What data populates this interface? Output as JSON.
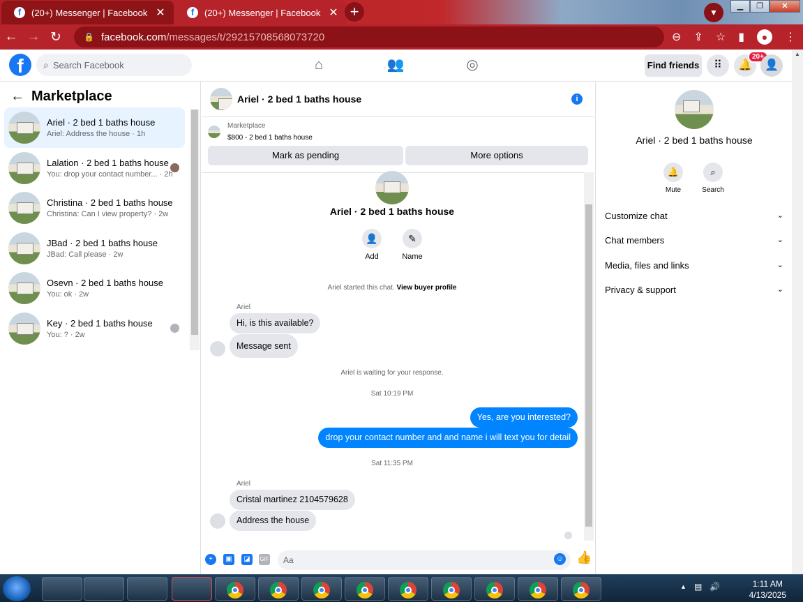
{
  "browser": {
    "tabs": [
      {
        "title": "(20+) Messenger | Facebook"
      },
      {
        "title": "(20+) Messenger | Facebook"
      }
    ],
    "url_host": "facebook.com",
    "url_path": "/messages/t/29215708568073720"
  },
  "header": {
    "search_placeholder": "Search Facebook",
    "find_friends": "Find friends",
    "notification_badge": "20+"
  },
  "sidebar": {
    "title": "Marketplace",
    "conversations": [
      {
        "name": "Ariel · 2 bed 1 baths house",
        "preview": "Ariel: Address the house · 1h"
      },
      {
        "name": "Lalation · 2 bed 1 baths house",
        "preview": "You: drop your contact number... · 2h"
      },
      {
        "name": "Christina · 2 bed 1 baths house",
        "preview": "Christina: Can I view property? · 2w"
      },
      {
        "name": "JBad · 2 bed 1 baths house",
        "preview": "JBad: Call please · 2w"
      },
      {
        "name": "Osevn · 2 bed 1 baths house",
        "preview": "You: ok · 2w"
      },
      {
        "name": "Key · 2 bed 1 baths house",
        "preview": "You: ? · 2w"
      }
    ]
  },
  "chat": {
    "title": "Ariel · 2 bed 1 baths house",
    "listing_label": "Marketplace",
    "listing_detail": "$800 - 2 bed 1 baths house",
    "mark_pending": "Mark as pending",
    "more_options": "More options",
    "hero_title": "Ariel · 2 bed 1 baths house",
    "add_label": "Add",
    "name_label": "Name",
    "started_note": "Ariel started this chat.",
    "view_profile": "View buyer profile",
    "sender1": "Ariel",
    "msg1": "Hi, is this available?",
    "msg2": "Message sent",
    "waiting_note": "Ariel is waiting for your response.",
    "time1": "Sat 10:19 PM",
    "out1": "Yes, are you interested?",
    "out2": "drop your contact number and and name i will text you for detail",
    "time2": "Sat 11:35 PM",
    "sender2": "Ariel",
    "msg3": "Cristal martinez  2104579628",
    "msg4": "Address the house",
    "composer_placeholder": "Aa",
    "gif_label": "GIF"
  },
  "right_panel": {
    "title": "Ariel · 2 bed 1 baths house",
    "mute_label": "Mute",
    "search_label": "Search",
    "rows": [
      "Customize chat",
      "Chat members",
      "Media, files and links",
      "Privacy & support"
    ]
  },
  "taskbar": {
    "time": "1:11 AM",
    "date": "4/13/2025"
  },
  "icons": [
    "facebook-icon",
    "search-icon",
    "home-icon",
    "friends-icon",
    "groups-icon",
    "grid-icon",
    "bell-icon",
    "account-icon",
    "info-icon",
    "add-person-icon",
    "pencil-icon",
    "plus-icon",
    "image-icon",
    "sticker-icon",
    "gif-icon",
    "emoji-icon",
    "like-icon",
    "chevron-down-icon",
    "back-arrow-icon"
  ],
  "colors": {
    "accent": "#1877f2",
    "outgoing_bubble": "#0084ff",
    "chrome_frame": "#b6232a",
    "badge": "#e41e3f"
  }
}
